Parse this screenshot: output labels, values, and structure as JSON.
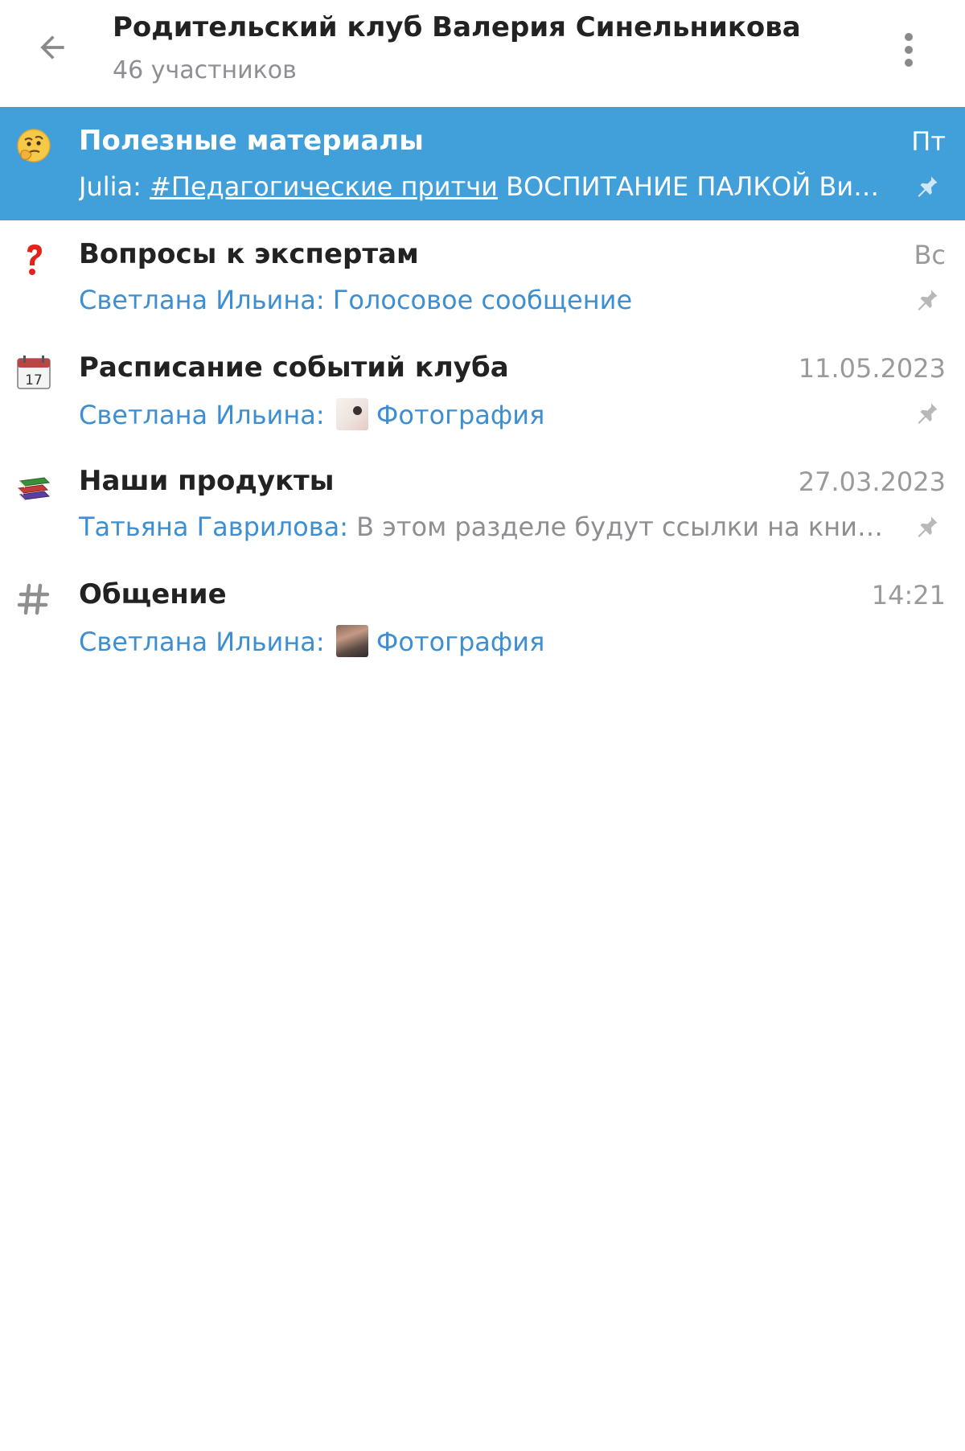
{
  "header": {
    "title": "Родительский клуб Валерия Синельникова",
    "subtitle": "46 участников",
    "back_icon": "arrow-left-icon",
    "menu_icon": "more-vertical-icon"
  },
  "colors": {
    "accent": "#419fd9",
    "sender": "#3d8fd1",
    "muted": "#8e8e93"
  },
  "topics": [
    {
      "icon": "thinking-face-emoji",
      "title": "Полезные материалы",
      "date": "Пт",
      "sender": "Julia:",
      "hashtag": "#Педагогические притчи",
      "text": " ВОСПИТАНИЕ ПАЛКОЙ  Вид...",
      "pinned": true,
      "active": true
    },
    {
      "icon": "red-question-mark-emoji",
      "title": "Вопросы к экспертам",
      "date": "Вс",
      "sender": "Светлана Ильина:",
      "media": "Голосовое сообщение",
      "pinned": true
    },
    {
      "icon": "calendar-emoji",
      "title": "Расписание событий клуба",
      "date": "11.05.2023",
      "sender": "Светлана Ильина:",
      "media": "Фотография",
      "pinned": true
    },
    {
      "icon": "books-emoji",
      "title": "Наши продукты",
      "date": "27.03.2023",
      "sender": "Татьяна Гаврилова:",
      "text": "В этом разделе будут ссылки на книги В...",
      "pinned": true
    },
    {
      "icon": "hash-icon",
      "title": "Общение",
      "date": "14:21",
      "sender": "Светлана Ильина:",
      "media": "Фотография",
      "pinned": false
    }
  ]
}
